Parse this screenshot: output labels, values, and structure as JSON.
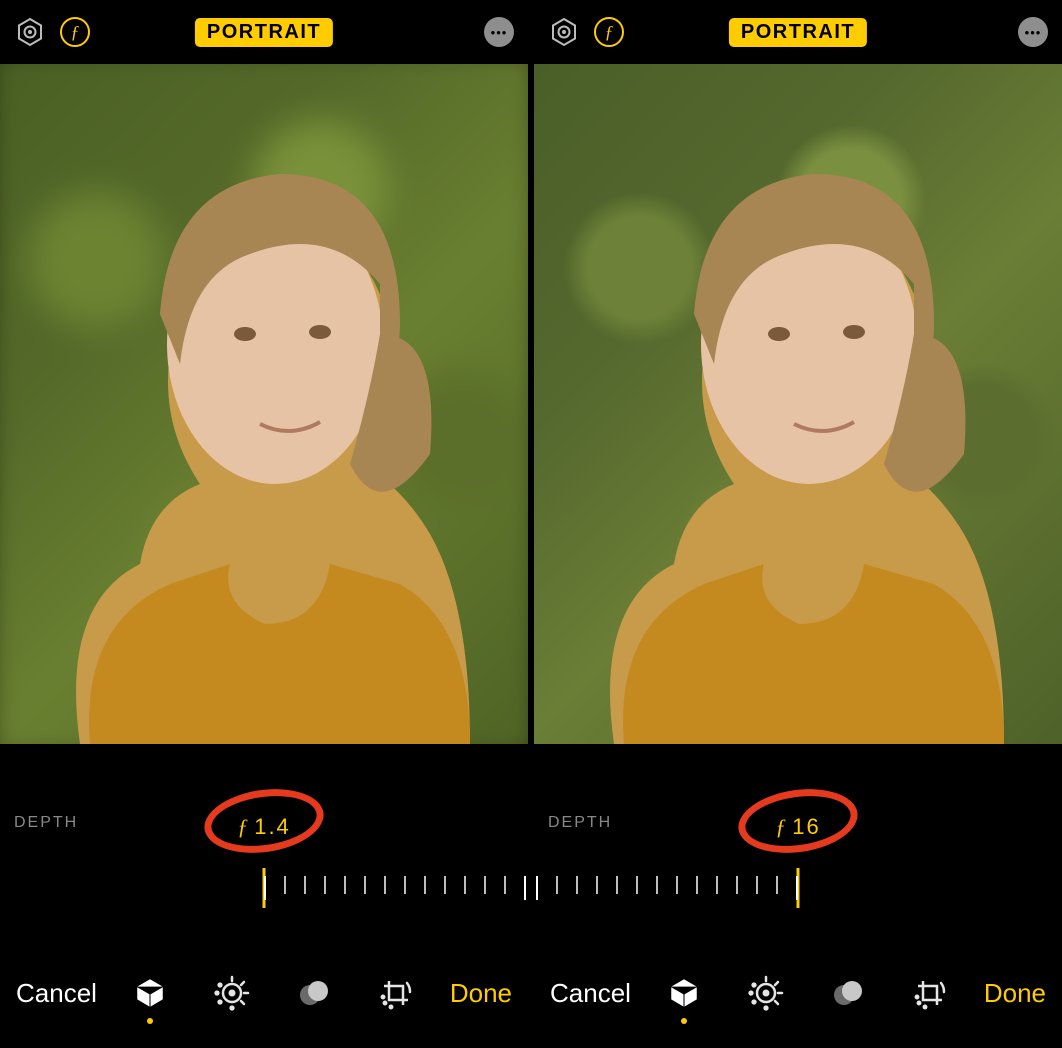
{
  "left": {
    "header": {
      "mode_label": "PORTRAIT",
      "live_icon": "live-photo-icon",
      "aperture_icon": "aperture-f-icon",
      "more_icon": "more-icon"
    },
    "depth": {
      "label": "DEPTH",
      "f_char": "ƒ",
      "f_value": "1.4",
      "slider_position": "min",
      "annotation_color": "#e63a1f"
    },
    "toolbar": {
      "cancel_label": "Cancel",
      "done_label": "Done",
      "tools": [
        {
          "name": "portrait-lighting-icon",
          "active": true
        },
        {
          "name": "adjust-dial-icon",
          "active": false
        },
        {
          "name": "filters-icon",
          "active": false
        },
        {
          "name": "crop-rotate-icon",
          "active": false
        }
      ]
    },
    "colors": {
      "accent": "#ffcc00"
    }
  },
  "right": {
    "header": {
      "mode_label": "PORTRAIT",
      "live_icon": "live-photo-icon",
      "aperture_icon": "aperture-f-icon",
      "more_icon": "more-icon"
    },
    "depth": {
      "label": "DEPTH",
      "f_char": "ƒ",
      "f_value": "16",
      "slider_position": "max",
      "annotation_color": "#e63a1f"
    },
    "toolbar": {
      "cancel_label": "Cancel",
      "done_label": "Done",
      "tools": [
        {
          "name": "portrait-lighting-icon",
          "active": true
        },
        {
          "name": "adjust-dial-icon",
          "active": false
        },
        {
          "name": "filters-icon",
          "active": false
        },
        {
          "name": "crop-rotate-icon",
          "active": false
        }
      ]
    },
    "colors": {
      "accent": "#ffcc00"
    }
  }
}
